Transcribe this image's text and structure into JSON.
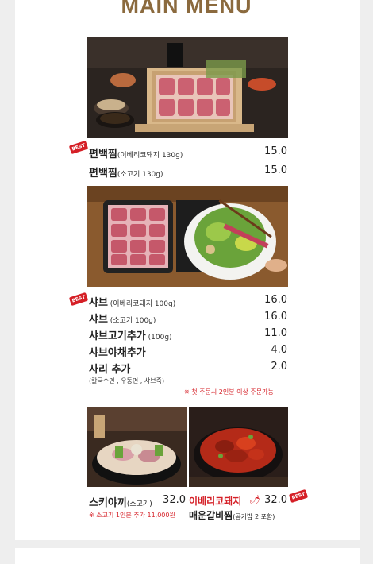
{
  "header": {
    "title": "MAIN MENU"
  },
  "badges": {
    "best": "BEST"
  },
  "section1": {
    "items": [
      {
        "name": "편백찜",
        "sub": "(이베리코돼지 130g)",
        "price": "15.0"
      },
      {
        "name": "편백찜",
        "sub": "(소고기 130g)",
        "price": "15.0"
      }
    ]
  },
  "section2": {
    "items": [
      {
        "name": "샤브",
        "sub": " (이베리코돼지 100g)",
        "price": "16.0"
      },
      {
        "name": "샤브",
        "sub": " (소고기 100g)",
        "price": "16.0"
      },
      {
        "name": "샤브고기추가",
        "sub": " (100g)",
        "price": "11.0"
      },
      {
        "name": "샤브야채추가",
        "sub": "",
        "price": "4.0"
      },
      {
        "name": "사리 추가",
        "sub": "",
        "price": "2.0"
      }
    ],
    "sari_detail": "(칼국수면 , 우동면 , 샤브죽)",
    "order_note": "※ 첫 주문시 2인분 이상 주문가능"
  },
  "section3": {
    "left": {
      "name": "스키야끼",
      "sub": "(소고기)",
      "price": "32.0",
      "note": "※ 소고기 1인분 추가 11,000원"
    },
    "right": {
      "name_line1": "이베리코돼지",
      "name_line2": "매운갈비찜",
      "sub": "(공기밥 2 포함)",
      "price": "32.0"
    }
  },
  "colors": {
    "accent_red": "#d51f26",
    "title_brown": "#8b6a3e",
    "background": "#eeeeee"
  }
}
